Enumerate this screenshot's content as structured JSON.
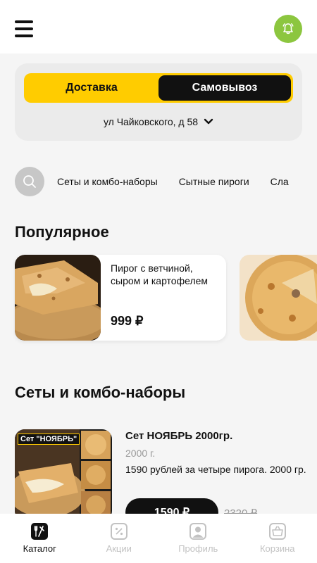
{
  "header": {
    "menu_icon": "hamburger-menu-icon",
    "bell_icon": "bell-icon",
    "accent": "#8cc63f"
  },
  "delivery": {
    "options": [
      "Доставка",
      "Самовывоз"
    ],
    "selected": "Самовывоз",
    "address": "ул Чайковского, д 58",
    "toggle_color": "#ffcc00"
  },
  "categories": {
    "search_icon": "search-icon",
    "items": [
      "Сеты и комбо-наборы",
      "Сытные пироги",
      "Сла"
    ]
  },
  "popular": {
    "title": "Популярное",
    "items": [
      {
        "name": "Пирог с ветчиной, сыром и картофелем",
        "price": "999 ₽"
      }
    ]
  },
  "sets": {
    "title": "Сеты и комбо-наборы",
    "items": [
      {
        "image_label": "Сет \"НОЯБРЬ\"",
        "name": "Сет НОЯБРЬ 2000гр.",
        "weight": "2000 г.",
        "description": "1590 рублей за четыре пирога. 2000 гр.",
        "price": "1590 ₽",
        "old_price": "2320 ₽"
      }
    ]
  },
  "nav": {
    "items": [
      {
        "label": "Каталог",
        "icon": "catalog-fork-knife-icon",
        "active": true
      },
      {
        "label": "Акции",
        "icon": "percent-badge-icon",
        "active": false
      },
      {
        "label": "Профиль",
        "icon": "profile-icon",
        "active": false
      },
      {
        "label": "Корзина",
        "icon": "basket-icon",
        "active": false
      }
    ]
  }
}
